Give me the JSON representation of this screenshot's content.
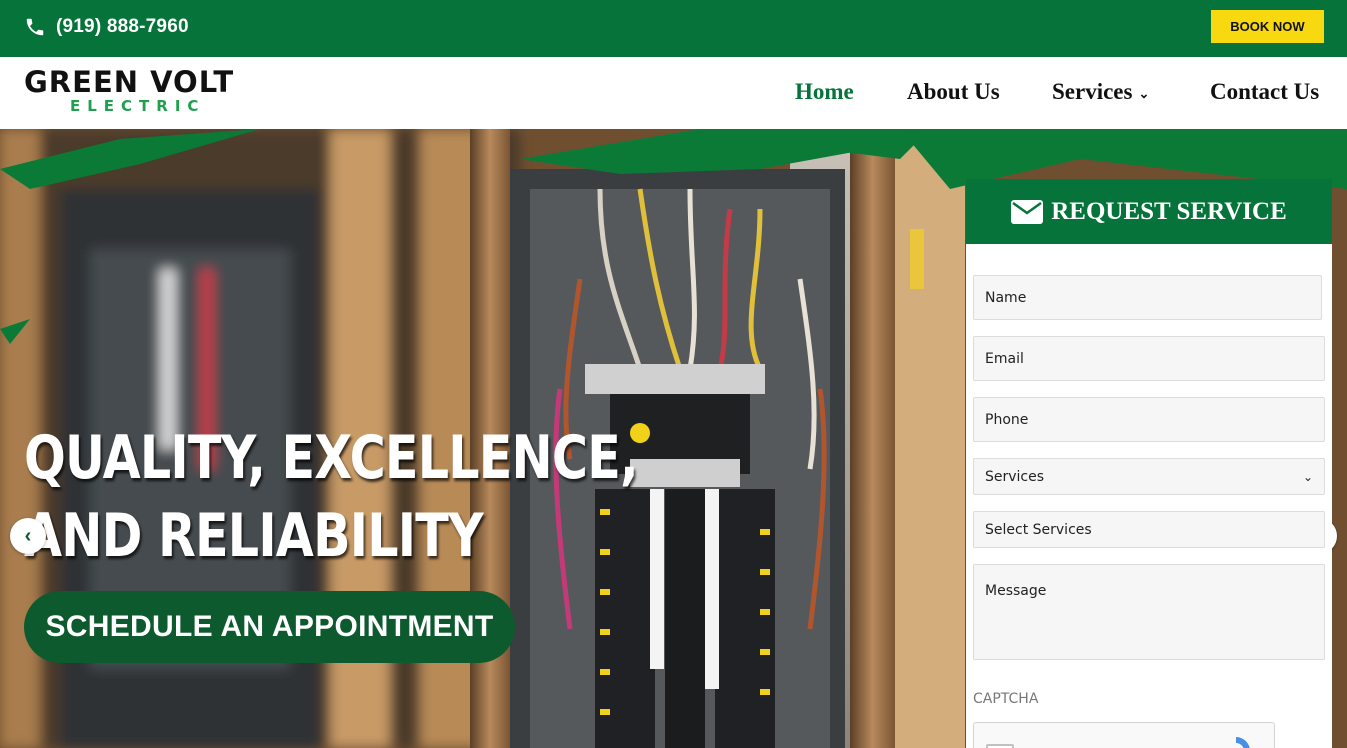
{
  "topbar": {
    "phone": "(919) 888-7960",
    "book_label": "BOOK NOW"
  },
  "brand": {
    "name_main": "GREEN VOLT",
    "name_sub": "ELECTRIC"
  },
  "nav": {
    "items": [
      {
        "label": "Home",
        "active": true
      },
      {
        "label": "About Us"
      },
      {
        "label": "Services",
        "has_dropdown": true
      },
      {
        "label": "Contact Us"
      }
    ]
  },
  "hero": {
    "headline_line1": "QUALITY, EXCELLENCE,",
    "headline_line2": "AND RELIABILITY",
    "cta_label": "SCHEDULE AN APPOINTMENT",
    "prev_icon": "chevron-left-icon",
    "next_icon": "chevron-right-icon"
  },
  "form": {
    "title": "REQUEST SERVICE",
    "title_icon": "envelope-icon",
    "name_placeholder": "Name",
    "email_placeholder": "Email",
    "phone_placeholder": "Phone",
    "services_select": "Services",
    "select_services": "Select Services",
    "message_placeholder": "Message",
    "captcha_label": "CAPTCHA"
  },
  "colors": {
    "brand_green": "#05733a",
    "dark_green": "#0e5a2f",
    "accent_yellow": "#f8d90f",
    "logo_green": "#1fa04e"
  }
}
